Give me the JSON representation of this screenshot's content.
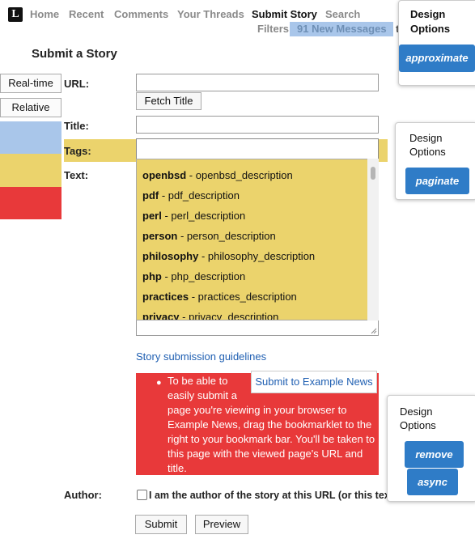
{
  "header": {
    "logo": "L",
    "nav": [
      "Home",
      "Recent",
      "Comments",
      "Your Threads",
      "Submit Story",
      "Search"
    ],
    "filters": "Filters",
    "new_messages": "91 New Messages",
    "cut_char": "t"
  },
  "page_title": "Submit a Story",
  "side": {
    "realtime": "Real-time",
    "relative": "Relative",
    "swatches": [
      "#a9c6ea",
      "#ebd36c",
      "#e8393a"
    ]
  },
  "form": {
    "url_label": "URL:",
    "fetch_title": "Fetch Title",
    "title_label": "Title:",
    "tags_label": "Tags:",
    "text_label": "Text:",
    "guidelines": "Story submission guidelines",
    "author_label": "Author:",
    "author_checkbox": "I am the author of the story at this URL (or this text)",
    "submit": "Submit",
    "preview": "Preview"
  },
  "tag_options": [
    {
      "name": "openbsd",
      "desc": "openbsd_description"
    },
    {
      "name": "pdf",
      "desc": "pdf_description"
    },
    {
      "name": "perl",
      "desc": "perl_description"
    },
    {
      "name": "person",
      "desc": "person_description"
    },
    {
      "name": "philosophy",
      "desc": "philosophy_description"
    },
    {
      "name": "php",
      "desc": "php_description"
    },
    {
      "name": "practices",
      "desc": "practices_description"
    },
    {
      "name": "privacy",
      "desc": "privacy_description"
    }
  ],
  "notice": {
    "lines": [
      "To be able to",
      "easily submit a",
      "page you're viewing in your browser to",
      "Example News, drag the bookmarklet to the",
      "right to your bookmark bar. You'll be taken to",
      "this page with the viewed page's URL and",
      "title."
    ],
    "bookmarklet": "Submit to Example News"
  },
  "design_panels": [
    {
      "title_lines": [
        "Design",
        "Options"
      ],
      "buttons": [
        "approximate"
      ]
    },
    {
      "title_lines": [
        "Design",
        "Options"
      ],
      "buttons": [
        "paginate"
      ]
    },
    {
      "title_lines": [
        "Design",
        "Options"
      ],
      "buttons": [
        "remove",
        "async"
      ]
    }
  ]
}
